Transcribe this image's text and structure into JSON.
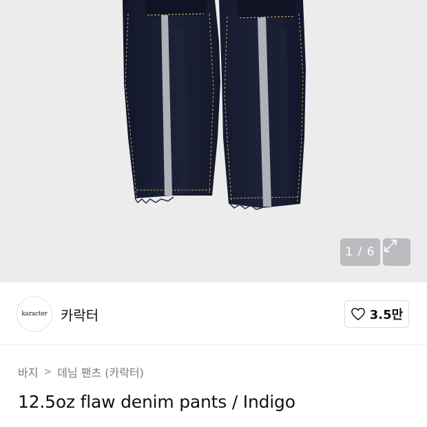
{
  "gallery": {
    "counter": "1 / 6",
    "expand_icon": "expand-arrows-icon"
  },
  "seller": {
    "logo_text": "karacter",
    "name": "카락터"
  },
  "like": {
    "icon": "heart-outline-icon",
    "count": "3.5만"
  },
  "breadcrumb": {
    "items": [
      "바지",
      "데님 팬츠 (카락터)"
    ],
    "separator": ">"
  },
  "product": {
    "title": "12.5oz flaw denim pants / Indigo"
  },
  "colors": {
    "hero_bg": "#ececed",
    "denim": "#171b2e",
    "stripe": "#aeb1b8"
  }
}
